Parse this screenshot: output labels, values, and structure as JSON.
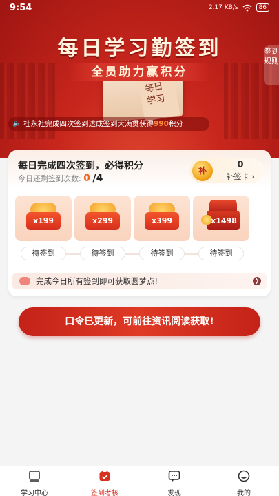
{
  "status_bar": {
    "time": "9:54",
    "network_speed": "2.17 KB/s",
    "battery": "86"
  },
  "hero": {
    "title": "每日学习勤签到",
    "subtitle": "全员助力赢积分",
    "book_text_line1": "每日",
    "book_text_line2": "学习",
    "rules_label": "签到规则",
    "ticker_prefix": "杜永社完成四次签到达成签到大满贯获得",
    "ticker_points": "990",
    "ticker_suffix": "积分"
  },
  "signin_card": {
    "title": "每日完成四次签到，必得积分",
    "remaining_label": "今日还剩签到次数:",
    "remaining_current": "0",
    "remaining_total": "/4",
    "makeup_card": {
      "count": "0",
      "label": "补签卡",
      "coin_glyph": "补"
    },
    "days": [
      {
        "reward": "x199",
        "status": "待签到",
        "kind": "bag"
      },
      {
        "reward": "x299",
        "status": "待签到",
        "kind": "bag"
      },
      {
        "reward": "x399",
        "status": "待签到",
        "kind": "bag"
      },
      {
        "reward": "x1498",
        "status": "待签到",
        "kind": "chest"
      }
    ],
    "tip": "完成今日所有签到即可获取圆梦点!"
  },
  "cta": {
    "label": "口令已更新，可前往资讯阅读获取!"
  },
  "tabbar": {
    "items": [
      {
        "label": "学习中心",
        "icon": "book-icon"
      },
      {
        "label": "签到考核",
        "icon": "calendar-check-icon"
      },
      {
        "label": "发现",
        "icon": "chat-icon"
      },
      {
        "label": "我的",
        "icon": "smiley-icon"
      }
    ],
    "active_color": "#d7311f"
  },
  "colors": {
    "brand_red": "#c8261c",
    "accent_orange": "#ef6a1e"
  }
}
